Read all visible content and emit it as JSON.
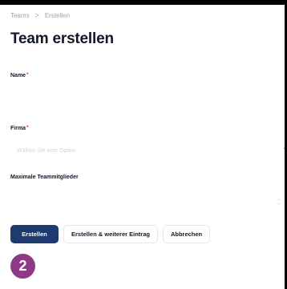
{
  "breadcrumb": {
    "items": [
      "Teams",
      "Erstellen"
    ],
    "separator": ">"
  },
  "page_title": "Team erstellen",
  "form": {
    "name": {
      "label": "Name",
      "required_mark": "*",
      "value": ""
    },
    "company": {
      "label": "Firma",
      "required_mark": "*",
      "placeholder": "Wählen Sie eine Option"
    },
    "max_members": {
      "label": "Maximale Teammitglieder",
      "value": ""
    }
  },
  "actions": {
    "create": "Erstellen",
    "create_another": "Erstellen & weiterer Eintrag",
    "cancel": "Abbrechen"
  },
  "step_badge": "2",
  "colors": {
    "primary": "#1e3a6e",
    "badge": "#8e3a86",
    "required": "#dc2626"
  }
}
